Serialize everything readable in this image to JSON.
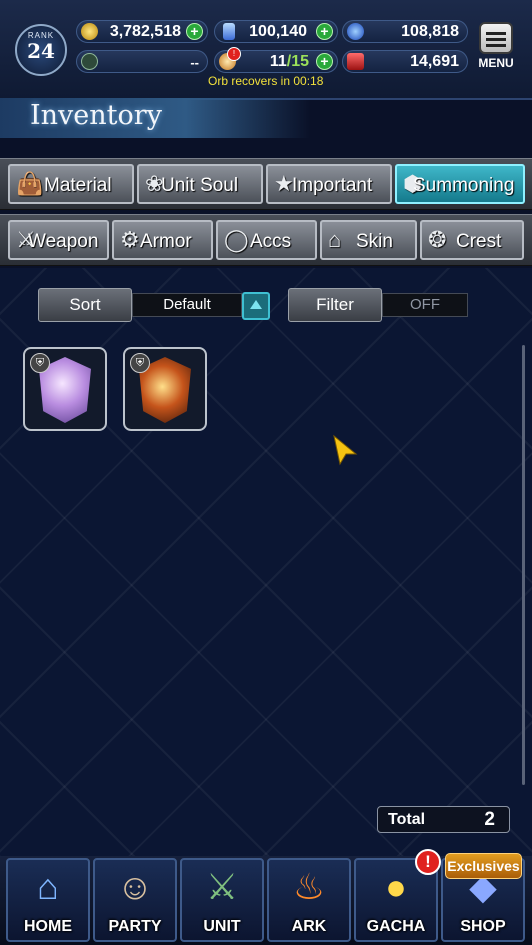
{
  "status": {
    "rank_label": "RANK",
    "rank_value": "24",
    "gil": "3,782,518",
    "gems": "100,140",
    "energy": "--",
    "orbs": "11",
    "orbs_max": "/15",
    "orb_timer": "Orb recovers in 00:18",
    "currency3": "108,818",
    "currency4": "14,691",
    "menu_label": "MENU"
  },
  "header": {
    "title": "Inventory"
  },
  "category_tabs": [
    {
      "label": "Material",
      "icon": "bag-icon"
    },
    {
      "label": "Unit Soul",
      "icon": "soul-icon"
    },
    {
      "label": "Important",
      "icon": "star-icon"
    },
    {
      "label": "Summoning",
      "icon": "crystal-icon",
      "active": true
    }
  ],
  "equip_tabs": [
    {
      "label": "Weapon",
      "icon": "sword-icon"
    },
    {
      "label": "Armor",
      "icon": "armor-icon"
    },
    {
      "label": "Accs",
      "icon": "ring-icon"
    },
    {
      "label": "Skin",
      "icon": "hanger-icon"
    },
    {
      "label": "Crest",
      "icon": "crest-icon"
    }
  ],
  "sort": {
    "label": "Sort",
    "value": "Default"
  },
  "filter": {
    "label": "Filter",
    "value": "OFF"
  },
  "items": [
    {
      "name": "summon-crystal-purple",
      "color": "#b98de0"
    },
    {
      "name": "summon-crystal-fire",
      "color": "#c5541b"
    }
  ],
  "total": {
    "label": "Total",
    "value": "2"
  },
  "nav": {
    "exclusives": "Exclusives",
    "alert": "!",
    "items": [
      "HOME",
      "PARTY",
      "UNIT",
      "ARK",
      "GACHA",
      "SHOP"
    ]
  },
  "colors": {
    "accent": "#3fb7c9",
    "orb_timer": "#f2e13c",
    "plus": "#29a83a"
  }
}
